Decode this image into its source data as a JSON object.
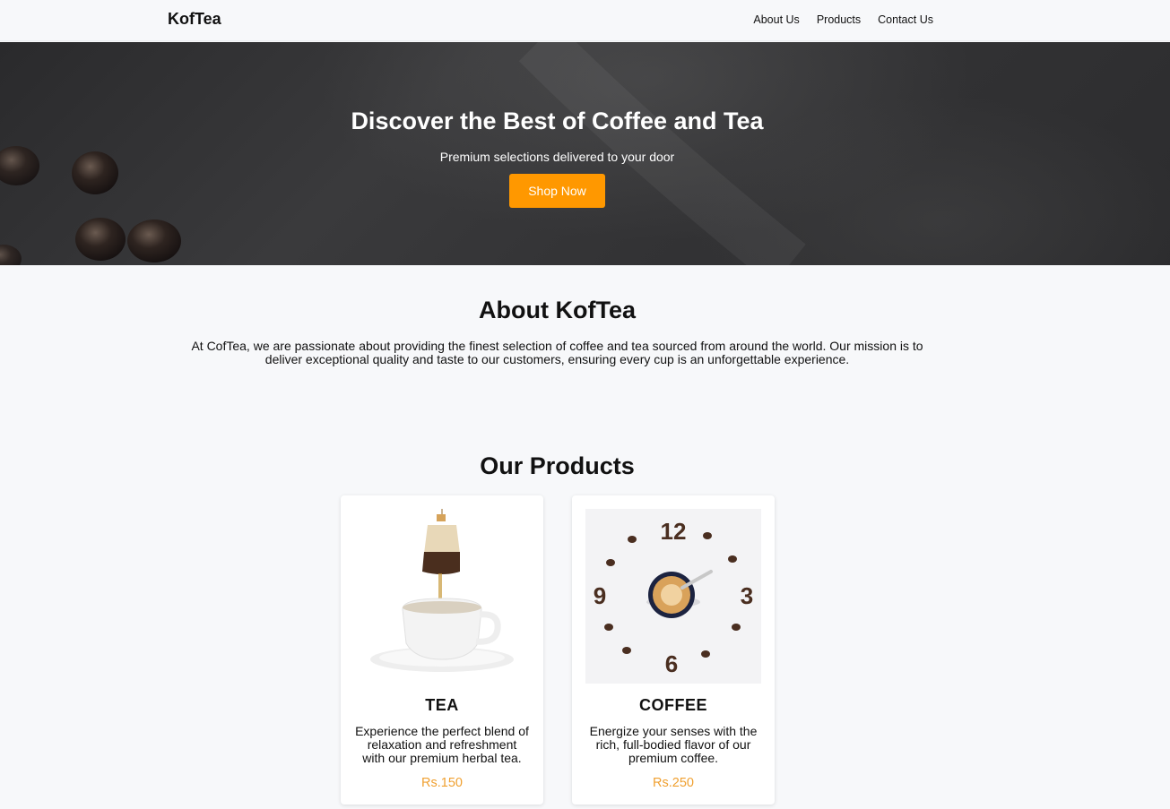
{
  "nav": {
    "brand": "KofTea",
    "links": [
      "About Us",
      "Products",
      "Contact Us"
    ]
  },
  "hero": {
    "title": "Discover the Best of Coffee and Tea",
    "subtitle": "Premium selections delivered to your door",
    "cta": "Shop Now"
  },
  "about": {
    "title": "About KofTea",
    "text": "At CofTea, we are passionate about providing the finest selection of coffee and tea sourced from around the world. Our mission is to deliver exceptional quality and taste to our customers, ensuring every cup is an unforgettable experience."
  },
  "products": {
    "title": "Our Products",
    "items": [
      {
        "name": "TEA",
        "description": "Experience the perfect blend of relaxation and refreshment with our premium herbal tea.",
        "price": "Rs.150",
        "image": "tea-bag-cup-image"
      },
      {
        "name": "COFFEE",
        "description": "Energize your senses with the rich, full-bodied flavor of our premium coffee.",
        "price": "Rs.250",
        "image": "coffee-clock-image"
      }
    ]
  },
  "colors": {
    "accent": "#ff9800",
    "price": "#f0a030",
    "background": "#f7f8fa"
  }
}
